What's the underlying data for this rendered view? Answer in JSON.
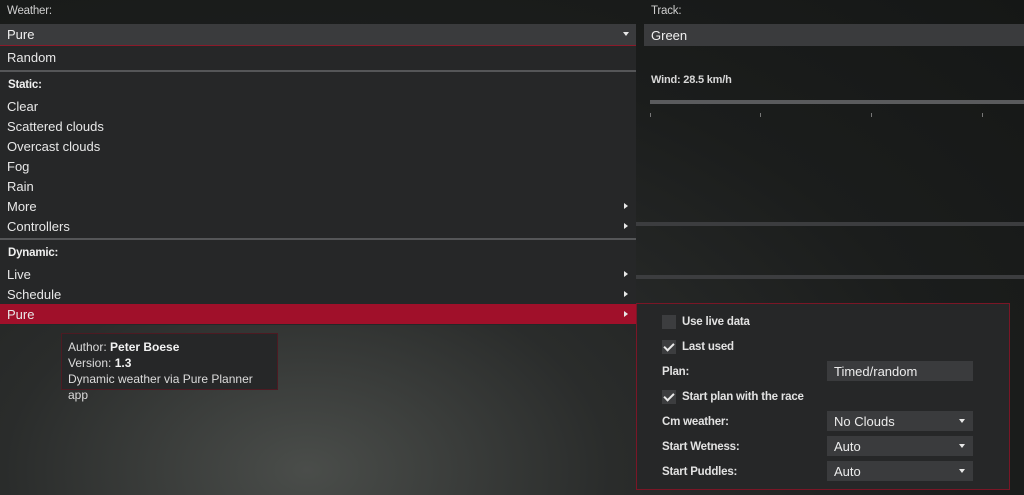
{
  "labels": {
    "weather": "Weather:",
    "track": "Track:"
  },
  "weather_select": {
    "value": "Pure"
  },
  "track_field": {
    "value": "Green"
  },
  "wind": {
    "label": "Wind: 28.5 km/h"
  },
  "menu": {
    "random": "Random",
    "static_header": "Static:",
    "static_items": [
      "Clear",
      "Scattered clouds",
      "Overcast clouds",
      "Fog",
      "Rain",
      "More",
      "Controllers"
    ],
    "dynamic_header": "Dynamic:",
    "dynamic_items": [
      "Live",
      "Schedule",
      "Pure"
    ]
  },
  "tooltip": {
    "author_prefix": "Author: ",
    "author": "Peter Boese",
    "version_prefix": "Version: ",
    "version": "1.3",
    "description": "Dynamic weather via Pure Planner app"
  },
  "pure_panel": {
    "use_live_data": {
      "label": "Use live data",
      "checked": false
    },
    "last_used": {
      "label": "Last used",
      "checked": true
    },
    "plan": {
      "label": "Plan:",
      "value": "Timed/random"
    },
    "start_plan": {
      "label": "Start plan with the race",
      "checked": true
    },
    "cm_weather": {
      "label": "Cm weather:",
      "value": "No Clouds"
    },
    "start_wetness": {
      "label": "Start Wetness:",
      "value": "Auto"
    },
    "start_puddles": {
      "label": "Start Puddles:",
      "value": "Auto"
    }
  },
  "colors": {
    "accent": "#a0102a",
    "panel": "#262728",
    "field": "#3a3b3d"
  }
}
